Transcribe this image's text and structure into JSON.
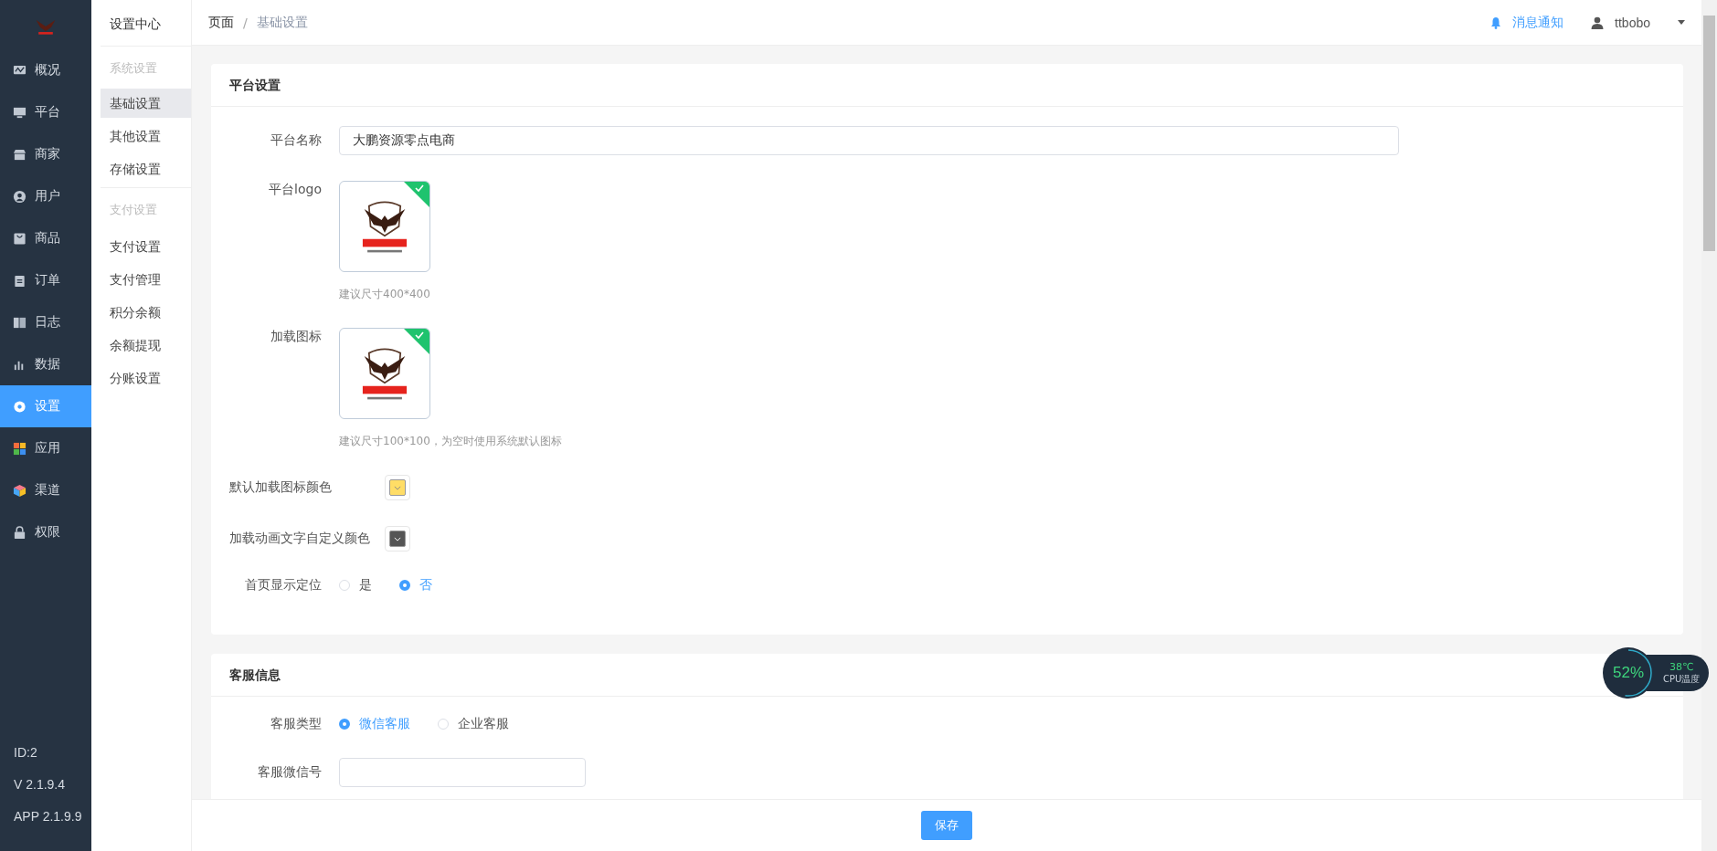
{
  "sidebar": {
    "items": [
      {
        "label": "概况",
        "selected": false
      },
      {
        "label": "平台",
        "selected": false
      },
      {
        "label": "商家",
        "selected": false
      },
      {
        "label": "用户",
        "selected": false
      },
      {
        "label": "商品",
        "selected": false
      },
      {
        "label": "订单",
        "selected": false
      },
      {
        "label": "日志",
        "selected": false
      },
      {
        "label": "数据",
        "selected": false
      },
      {
        "label": "设置",
        "selected": true
      },
      {
        "label": "应用",
        "selected": false
      },
      {
        "label": "渠道",
        "selected": false
      },
      {
        "label": "权限",
        "selected": false
      }
    ],
    "footer": [
      "ID:2",
      "V 2.1.9.4",
      "APP 2.1.9.9"
    ]
  },
  "subnav": {
    "title": "设置中心",
    "groups": [
      {
        "heading": "系统设置",
        "items": [
          {
            "label": "基础设置",
            "selected": true
          },
          {
            "label": "其他设置",
            "selected": false
          },
          {
            "label": "存储设置",
            "selected": false
          }
        ]
      },
      {
        "heading": "支付设置",
        "items": [
          {
            "label": "支付设置",
            "selected": false
          },
          {
            "label": "支付管理",
            "selected": false
          },
          {
            "label": "积分余额",
            "selected": false
          },
          {
            "label": "余额提现",
            "selected": false
          },
          {
            "label": "分账设置",
            "selected": false
          }
        ]
      }
    ]
  },
  "breadcrumb": [
    "页面",
    "基础设置"
  ],
  "breadcrumb_separator": "/",
  "header": {
    "notifications": "消息通知",
    "user": "ttbobo"
  },
  "sections": [
    {
      "title": "平台设置",
      "fields": [
        {
          "kind": "text",
          "label": "平台名称",
          "value": "大鹏资源零点电商"
        },
        {
          "label": "平台logo",
          "uploaded": true,
          "hint": "建议尺寸400*400"
        },
        {
          "label": "加载图标",
          "uploaded": true,
          "hint": "建议尺寸100*100，为空时使用系统默认图标"
        },
        {
          "kind": "color",
          "label": "默认加载图标颜色",
          "color": "#ffdd66"
        },
        {
          "kind": "color",
          "label": "加载动画文字自定义颜色",
          "color": "#555555"
        },
        {
          "kind": "radio",
          "label": "首页显示定位",
          "options": [
            {
              "label": "是",
              "selected": false
            },
            {
              "label": "否",
              "selected": true
            }
          ]
        }
      ]
    },
    {
      "title": "客服信息",
      "fields": [
        {
          "kind": "radio",
          "label": "客服类型",
          "options": [
            {
              "label": "微信客服",
              "selected": true
            },
            {
              "label": "企业客服",
              "selected": false
            }
          ]
        },
        {
          "kind": "short_text",
          "label": "客服微信号"
        }
      ]
    }
  ],
  "save_button": "保存",
  "cpu_widget": {
    "usage": "52%",
    "temperature": "38℃",
    "label": "CPU温度",
    "level": 0.52
  }
}
